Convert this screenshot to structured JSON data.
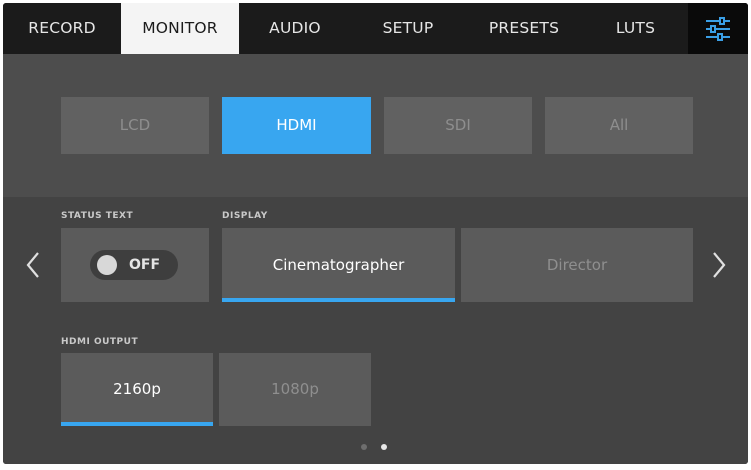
{
  "tabs": [
    {
      "label": "RECORD",
      "active": false
    },
    {
      "label": "MONITOR",
      "active": true
    },
    {
      "label": "AUDIO",
      "active": false
    },
    {
      "label": "SETUP",
      "active": false
    },
    {
      "label": "PRESETS",
      "active": false
    },
    {
      "label": "LUTS",
      "active": false
    }
  ],
  "settings_icon": "sliders-icon",
  "sources": [
    {
      "label": "LCD",
      "active": false
    },
    {
      "label": "HDMI",
      "active": true
    },
    {
      "label": "SDI",
      "active": false
    },
    {
      "label": "All",
      "active": false
    }
  ],
  "status_text": {
    "label": "STATUS TEXT",
    "toggle_label": "OFF",
    "enabled": false
  },
  "display": {
    "label": "DISPLAY",
    "options": [
      {
        "label": "Cinematographer",
        "active": true
      },
      {
        "label": "Director",
        "active": false
      }
    ]
  },
  "hdmi_output": {
    "label": "HDMI OUTPUT",
    "options": [
      {
        "label": "2160p",
        "active": true
      },
      {
        "label": "1080p",
        "active": false
      }
    ]
  },
  "pagination": {
    "pages": 2,
    "current": 2
  },
  "colors": {
    "accent": "#38a6f0",
    "tab_bar": "#1b1b1b",
    "active_tab": "#f4f4f4",
    "panel": "#434343",
    "button": "#5b5b5b"
  }
}
